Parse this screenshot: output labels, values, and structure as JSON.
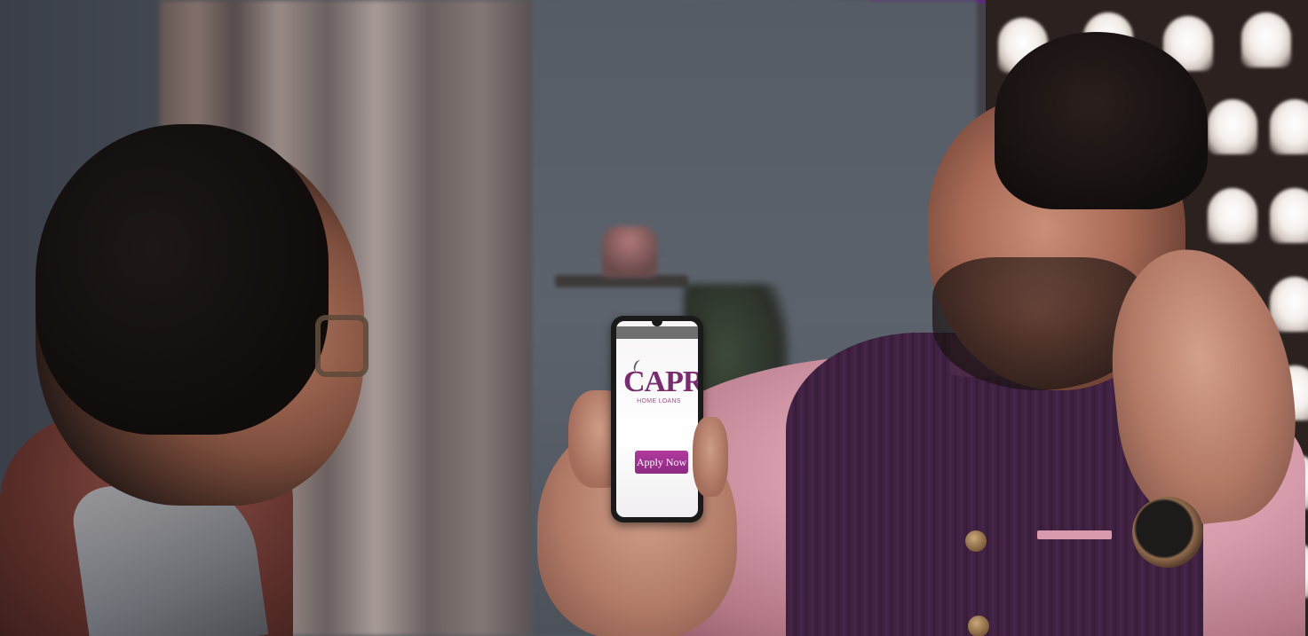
{
  "scene": {
    "description_hidden": "",
    "accent_color": "#8e2a82"
  },
  "phone": {
    "logo_text": "CAPRI",
    "logo_subtext": "HOME LOANS",
    "cta_label": "Apply Now"
  }
}
